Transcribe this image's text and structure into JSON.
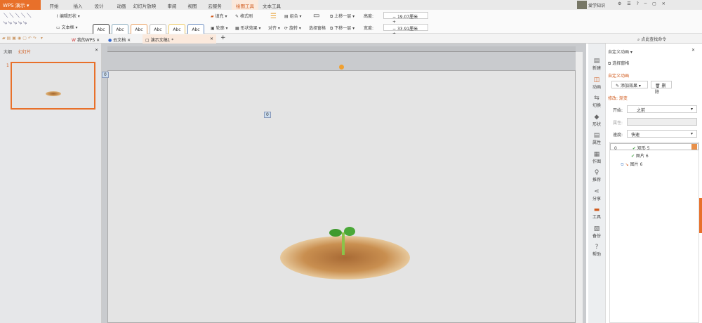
{
  "app": {
    "logo": "WPS 演示"
  },
  "ribbon_tabs": [
    "开始",
    "插入",
    "设计",
    "动画",
    "幻灯片放映",
    "审阅",
    "视图",
    "云服务",
    "绘图工具",
    "文本工具"
  ],
  "active_tab": "绘图工具",
  "user": {
    "name": "爱学知识"
  },
  "ribbon": {
    "edit_shape": "编辑形状",
    "textbox": "文本框",
    "abc": "Abc",
    "fill": "填充",
    "format_painter": "格式刷",
    "outline": "轮廓",
    "shape_effect": "形状效果",
    "align": "对齐",
    "group": "组合",
    "rotate": "旋转",
    "selection_pane": "选择窗格",
    "bring_forward": "上移一层",
    "send_backward": "下移一层",
    "height_label": "高度:",
    "height_value": "19.07厘米",
    "width_label": "宽度:",
    "width_value": "33.91厘米"
  },
  "doc_tabs": [
    {
      "label": "我的WPS"
    },
    {
      "label": "云文档"
    },
    {
      "label": "演示文稿1 *"
    }
  ],
  "search": {
    "placeholder": "点此查找命令"
  },
  "left_panel": {
    "tab_outline": "大纲",
    "tab_slides": "幻灯片",
    "slide_number": "1"
  },
  "canvas": {
    "anim_tag1": "0",
    "anim_tag2": "0"
  },
  "side_strip": [
    "新建",
    "动画",
    "切换",
    "形状",
    "属性",
    "作图",
    "推荐",
    "分享",
    "工具",
    "备份",
    "帮助"
  ],
  "right_panel": {
    "title": "自定义动画",
    "selection_pane": "选择窗格",
    "section": "自定义动画",
    "add_effect": "添加效果",
    "delete": "删除",
    "modify": "修改: 渐变",
    "start_label": "开始:",
    "start_value": "之前",
    "property_label": "属性:",
    "speed_label": "速度:",
    "speed_value": "快速",
    "items": [
      {
        "index": "0",
        "name": "矩形 5"
      },
      {
        "index": "",
        "name": "图片 6"
      },
      {
        "index": "",
        "name": "图片 6"
      }
    ]
  },
  "colors": {
    "accent": "#e8702a"
  }
}
